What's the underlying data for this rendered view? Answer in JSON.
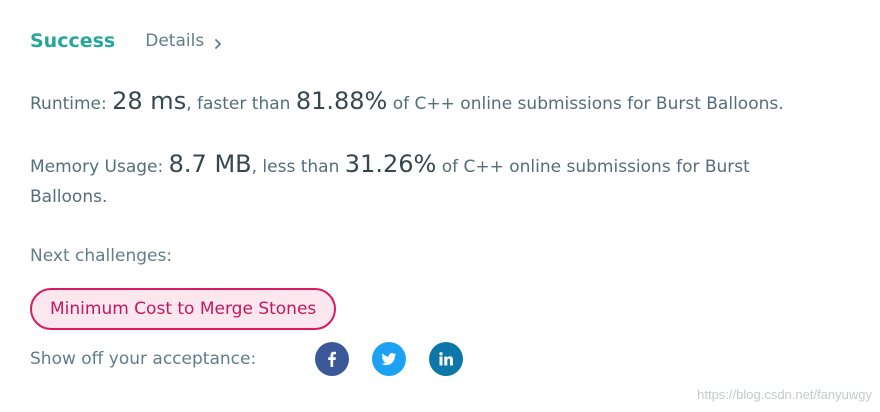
{
  "header": {
    "status": "Success",
    "details_label": "Details"
  },
  "runtime": {
    "label": "Runtime:",
    "value": "28 ms",
    "comparison": ", faster than",
    "percent": "81.88%",
    "suffix": "of C++ online submissions for Burst Balloons."
  },
  "memory": {
    "label": "Memory Usage:",
    "value": "8.7 MB",
    "comparison": ", less than",
    "percent": "31.26%",
    "suffix": "of C++ online submissions for Burst Balloons."
  },
  "next": {
    "label": "Next challenges:",
    "challenges": [
      "Minimum Cost to Merge Stones"
    ]
  },
  "share": {
    "label": "Show off your acceptance:",
    "icons": [
      "facebook-icon",
      "twitter-icon",
      "linkedin-icon"
    ]
  },
  "watermark": "https://blog.csdn.net/fanyuwgy",
  "colors": {
    "success": "#26a69a",
    "challenge_border": "#d81b60",
    "challenge_bg": "#fde7ee",
    "facebook": "#3b5998",
    "twitter": "#1da1f2",
    "linkedin": "#0e76a8"
  }
}
